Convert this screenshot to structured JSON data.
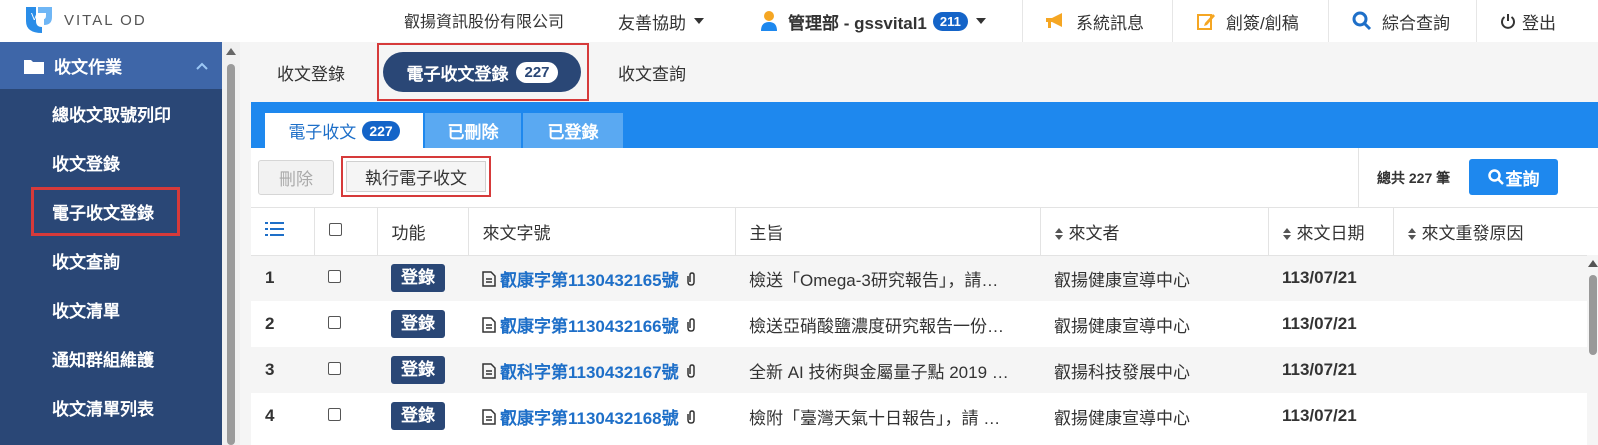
{
  "header": {
    "logo_text": "VITAL OD",
    "company": "叡揚資訊股份有限公司",
    "help": "友善協助",
    "user": "管理部 - gssvital1",
    "user_badge": "211",
    "messages": "系統訊息",
    "sign": "創簽/創稿",
    "query": "綜合查詢",
    "logout": "登出"
  },
  "sidebar": {
    "section": "收文作業",
    "items": [
      {
        "label": "總收文取號列印"
      },
      {
        "label": "收文登錄"
      },
      {
        "label": "電子收文登錄"
      },
      {
        "label": "收文查詢"
      },
      {
        "label": "收文清單"
      },
      {
        "label": "通知群組維護"
      },
      {
        "label": "收文清單列表"
      }
    ]
  },
  "top_tabs": {
    "tab1": "收文登錄",
    "tab2": "電子收文登錄",
    "tab2_count": "227",
    "tab3": "收文查詢"
  },
  "panel_tabs": {
    "tab1": "電子收文",
    "tab1_count": "227",
    "tab2": "已刪除",
    "tab3": "已登錄"
  },
  "toolbar": {
    "delete": "刪除",
    "execute": "執行電子收文",
    "total": "總共 227 筆",
    "search": "查詢"
  },
  "table": {
    "headers": {
      "func": "功能",
      "docno": "來文字號",
      "subject": "主旨",
      "sender": "來文者",
      "date": "來文日期",
      "reason": "來文重發原因"
    },
    "rows": [
      {
        "no": "1",
        "action": "登錄",
        "docno": "叡康字第1130432165號",
        "subject": "檢送「Omega-3研究報告」，請…",
        "sender": "叡揚健康宣導中心",
        "date": "113/07/21",
        "reason": ""
      },
      {
        "no": "2",
        "action": "登錄",
        "docno": "叡康字第1130432166號",
        "subject": "檢送亞硝酸鹽濃度研究報告一份…",
        "sender": "叡揚健康宣導中心",
        "date": "113/07/21",
        "reason": ""
      },
      {
        "no": "3",
        "action": "登錄",
        "docno": "叡科字第1130432167號",
        "subject": "全新 AI 技術與金屬量子點 2019 …",
        "sender": "叡揚科技發展中心",
        "date": "113/07/21",
        "reason": ""
      },
      {
        "no": "4",
        "action": "登錄",
        "docno": "叡康字第1130432168號",
        "subject": "檢附「臺灣天氣十日報告」，請 …",
        "sender": "叡揚健康宣導中心",
        "date": "113/07/21",
        "reason": ""
      }
    ]
  },
  "colors": {
    "sidebar_bg": "#2a4776",
    "sidebar_head": "#3e66a8",
    "accent_blue": "#1e88ee",
    "highlight_red": "#d63a3a",
    "link_blue": "#1e6fc8"
  }
}
